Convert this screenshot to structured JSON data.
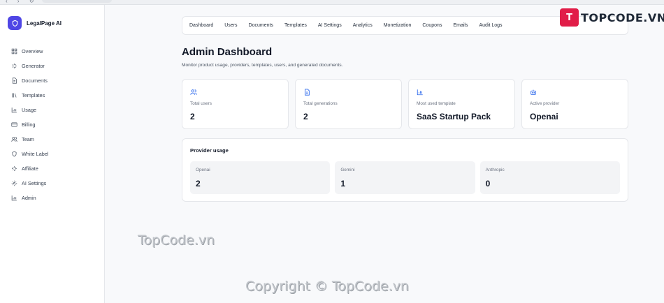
{
  "sidebar": {
    "brand": "LegalPage AI",
    "items": [
      {
        "label": "Overview",
        "icon": "grid-icon"
      },
      {
        "label": "Generator",
        "icon": "sparkles-icon"
      },
      {
        "label": "Documents",
        "icon": "file-icon"
      },
      {
        "label": "Templates",
        "icon": "library-icon"
      },
      {
        "label": "Usage",
        "icon": "bar-chart-icon"
      },
      {
        "label": "Billing",
        "icon": "credit-card-icon"
      },
      {
        "label": "Team",
        "icon": "users-icon"
      },
      {
        "label": "White Label",
        "icon": "shield-icon"
      },
      {
        "label": "Affiliate",
        "icon": "sparkles-icon"
      },
      {
        "label": "AI Settings",
        "icon": "gear-icon"
      },
      {
        "label": "Admin",
        "icon": "bar-chart-icon"
      }
    ]
  },
  "tabs": [
    "Dashboard",
    "Users",
    "Documents",
    "Templates",
    "AI Settings",
    "Analytics",
    "Monetization",
    "Coupons",
    "Emails",
    "Audit Logs"
  ],
  "header": {
    "title": "Admin Dashboard",
    "subtitle": "Monitor product usage, providers, templates, users, and generated documents."
  },
  "stats": [
    {
      "label": "Total users",
      "value": "2",
      "icon": "users-icon"
    },
    {
      "label": "Total generations",
      "value": "2",
      "icon": "file-icon"
    },
    {
      "label": "Most used template",
      "value": "SaaS Startup Pack",
      "icon": "bar-chart-icon"
    },
    {
      "label": "Active provider",
      "value": "Openai",
      "icon": "bot-icon"
    }
  ],
  "provider_usage": {
    "title": "Provider usage",
    "providers": [
      {
        "name": "Openai",
        "count": "2"
      },
      {
        "name": "Gemini",
        "count": "1"
      },
      {
        "name": "Anthropic",
        "count": "0"
      }
    ]
  },
  "watermark": {
    "logo_letter": "T",
    "logo_text": "TOPCODE.VN",
    "mid_text": "TopCode.vn",
    "copyright": "Copyright © TopCode.vn"
  },
  "colors": {
    "accent": "#4f46e5",
    "icon_blue": "#2563eb",
    "background": "#f8f9fb",
    "card": "#ffffff",
    "tile": "#f3f4f6"
  }
}
